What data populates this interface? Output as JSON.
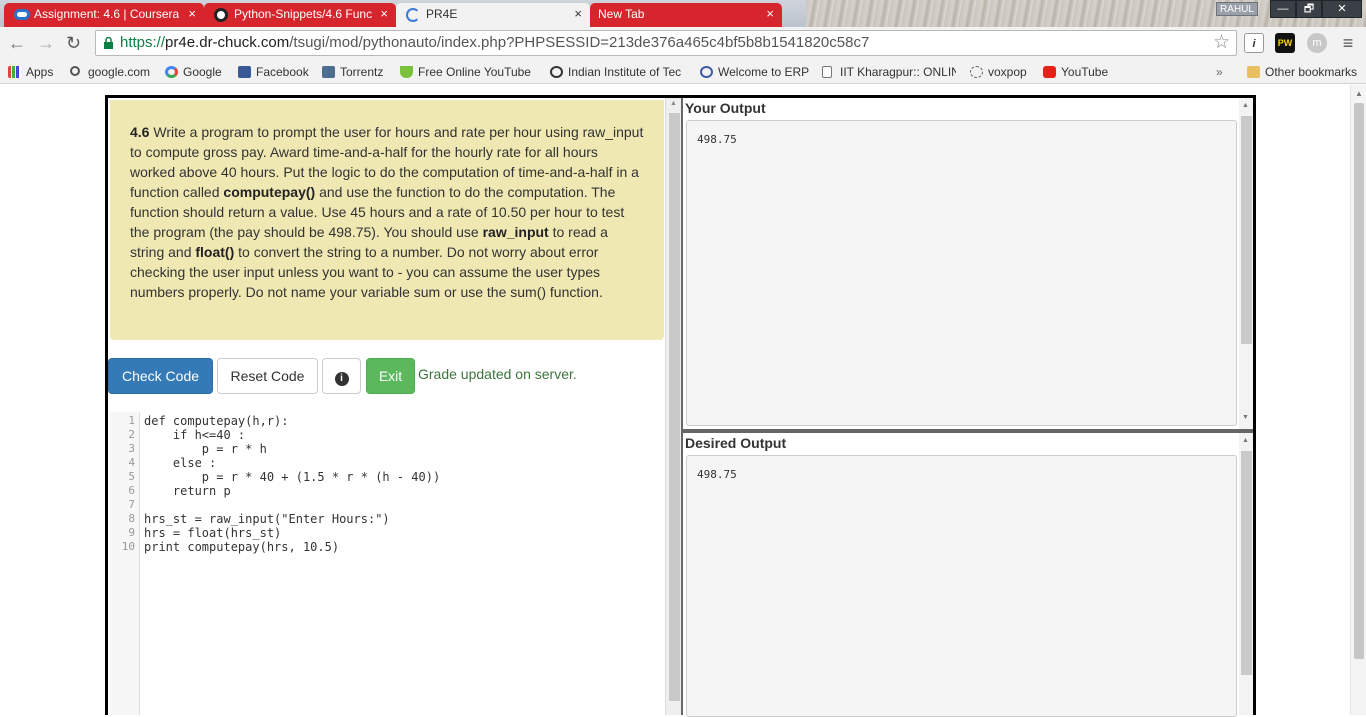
{
  "browser": {
    "tabs": [
      {
        "label": "Assignment: 4.6 | Coursera",
        "close": "×"
      },
      {
        "label": "Python-Snippets/4.6 Func",
        "close": "×"
      },
      {
        "label": "PR4E",
        "close": "×"
      },
      {
        "label": "New Tab",
        "close": "×"
      }
    ],
    "user_badge": "RAHUL",
    "window_buttons": {
      "minimize": "—",
      "restore": "🗗",
      "close": "✕"
    },
    "url": {
      "scheme": "https://",
      "host": "pr4e.dr-chuck.com",
      "path": "/tsugi/mod/pythonauto/index.php?PHPSESSID=213de376a465c4bf5b8b1541820c58c7"
    },
    "extensions": {
      "info": "i",
      "pw": "PW",
      "m": "m",
      "menu": "≡"
    },
    "bookmarks": [
      {
        "label": "Apps",
        "icon": "apps-grid-icon"
      },
      {
        "label": "google.com",
        "icon": "search-icon"
      },
      {
        "label": "Google",
        "icon": "google-icon"
      },
      {
        "label": "Facebook",
        "icon": "facebook-icon"
      },
      {
        "label": "Torrentz",
        "icon": "torrentz-icon"
      },
      {
        "label": "Free Online YouTube",
        "icon": "download-arrow-icon"
      },
      {
        "label": "Indian Institute of Tec",
        "icon": "institute-logo-icon"
      },
      {
        "label": "Welcome to ERP",
        "icon": "erp-logo-icon"
      },
      {
        "label": "IIT Kharagpur:: ONLIN",
        "icon": "page-icon"
      },
      {
        "label": "voxpop",
        "icon": "voxpop-icon"
      },
      {
        "label": "YouTube",
        "icon": "youtube-icon"
      },
      {
        "label": "»",
        "icon": ""
      },
      {
        "label": "Other bookmarks",
        "icon": "folder-icon"
      }
    ],
    "colors": {
      "tab_red": "#d6252c",
      "https_green": "#0b8043"
    }
  },
  "instructions": {
    "number": "4.6",
    "p1": " Write a program to prompt the user for hours and rate per hour using raw_input to compute gross pay. Award time-and-a-half for the hourly rate for all hours worked above 40 hours. Put the logic to do the computation of time-and-a-half in a function called ",
    "bold1": "computepay()",
    "p2": " and use the function to do the computation. The function should return a value. Use 45 hours and a rate of 10.50 per hour to test the program (the pay should be 498.75). You should use ",
    "bold2": "raw_input",
    "p3": " to read a string and ",
    "bold3": "float()",
    "p4": " to convert the string to a number. Do not worry about error checking the user input unless you want to - you can assume the user types numbers properly. Do not name your variable sum or use the sum() function."
  },
  "buttons": {
    "check": "Check Code",
    "reset": "Reset Code",
    "info": "i",
    "exit": "Exit"
  },
  "grade_message": "Grade updated on server.",
  "code_lines": [
    "def computepay(h,r):",
    "    if h<=40 :",
    "        p = r * h",
    "    else :",
    "        p = r * 40 + (1.5 * r * (h - 40))",
    "    return p",
    "",
    "hrs_st = raw_input(\"Enter Hours:\")",
    "hrs = float(hrs_st)",
    "print computepay(hrs, 10.5)"
  ],
  "line_numbers": [
    "1",
    "2",
    "3",
    "4",
    "5",
    "6",
    "7",
    "8",
    "9",
    "10"
  ],
  "your_output": {
    "title": "Your Output",
    "value": "498.75"
  },
  "desired_output": {
    "title": "Desired Output",
    "value": "498.75"
  }
}
